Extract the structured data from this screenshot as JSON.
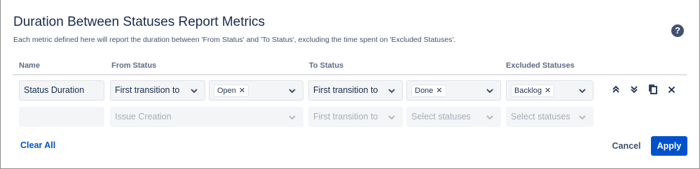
{
  "dialog": {
    "title": "Duration Between Statuses Report Metrics",
    "subtitle": "Each metric defined here will report the duration between 'From Status' and 'To Status', excluding the time spent on 'Excluded Statuses'."
  },
  "table": {
    "headers": {
      "name": "Name",
      "from_status": "From Status",
      "to_status": "To Status",
      "excluded_statuses": "Excluded Statuses"
    },
    "rows": [
      {
        "name": "Status Duration",
        "from_mode": "First transition to",
        "from_tag": "Open",
        "to_mode": "First transition to",
        "to_tag": "Done",
        "excluded_tag": "Backlog"
      },
      {
        "name": "",
        "from_mode": "Issue Creation",
        "to_mode": "First transition to",
        "to_placeholder": "Select statuses",
        "excluded_placeholder": "Select statuses"
      }
    ]
  },
  "footer": {
    "clear_all": "Clear All",
    "cancel": "Cancel",
    "apply": "Apply"
  },
  "colors": {
    "primary": "#0052cc",
    "text": "#172b4d",
    "muted": "#a5adba"
  },
  "icons": [
    "help-icon",
    "chevron-down-icon",
    "move-up-icon",
    "move-down-icon",
    "copy-icon",
    "close-icon",
    "remove-tag-icon"
  ]
}
